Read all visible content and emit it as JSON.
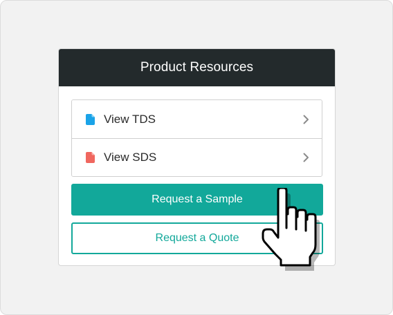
{
  "card": {
    "title": "Product Resources"
  },
  "documents": [
    {
      "label": "View TDS",
      "icon": "document-icon",
      "color": "#1aa3e8"
    },
    {
      "label": "View SDS",
      "icon": "document-icon",
      "color": "#f0675f"
    }
  ],
  "buttons": {
    "primary_label": "Request a Sample",
    "secondary_label": "Request a Quote"
  },
  "colors": {
    "header_bg": "#232a2c",
    "accent": "#12a89a"
  }
}
